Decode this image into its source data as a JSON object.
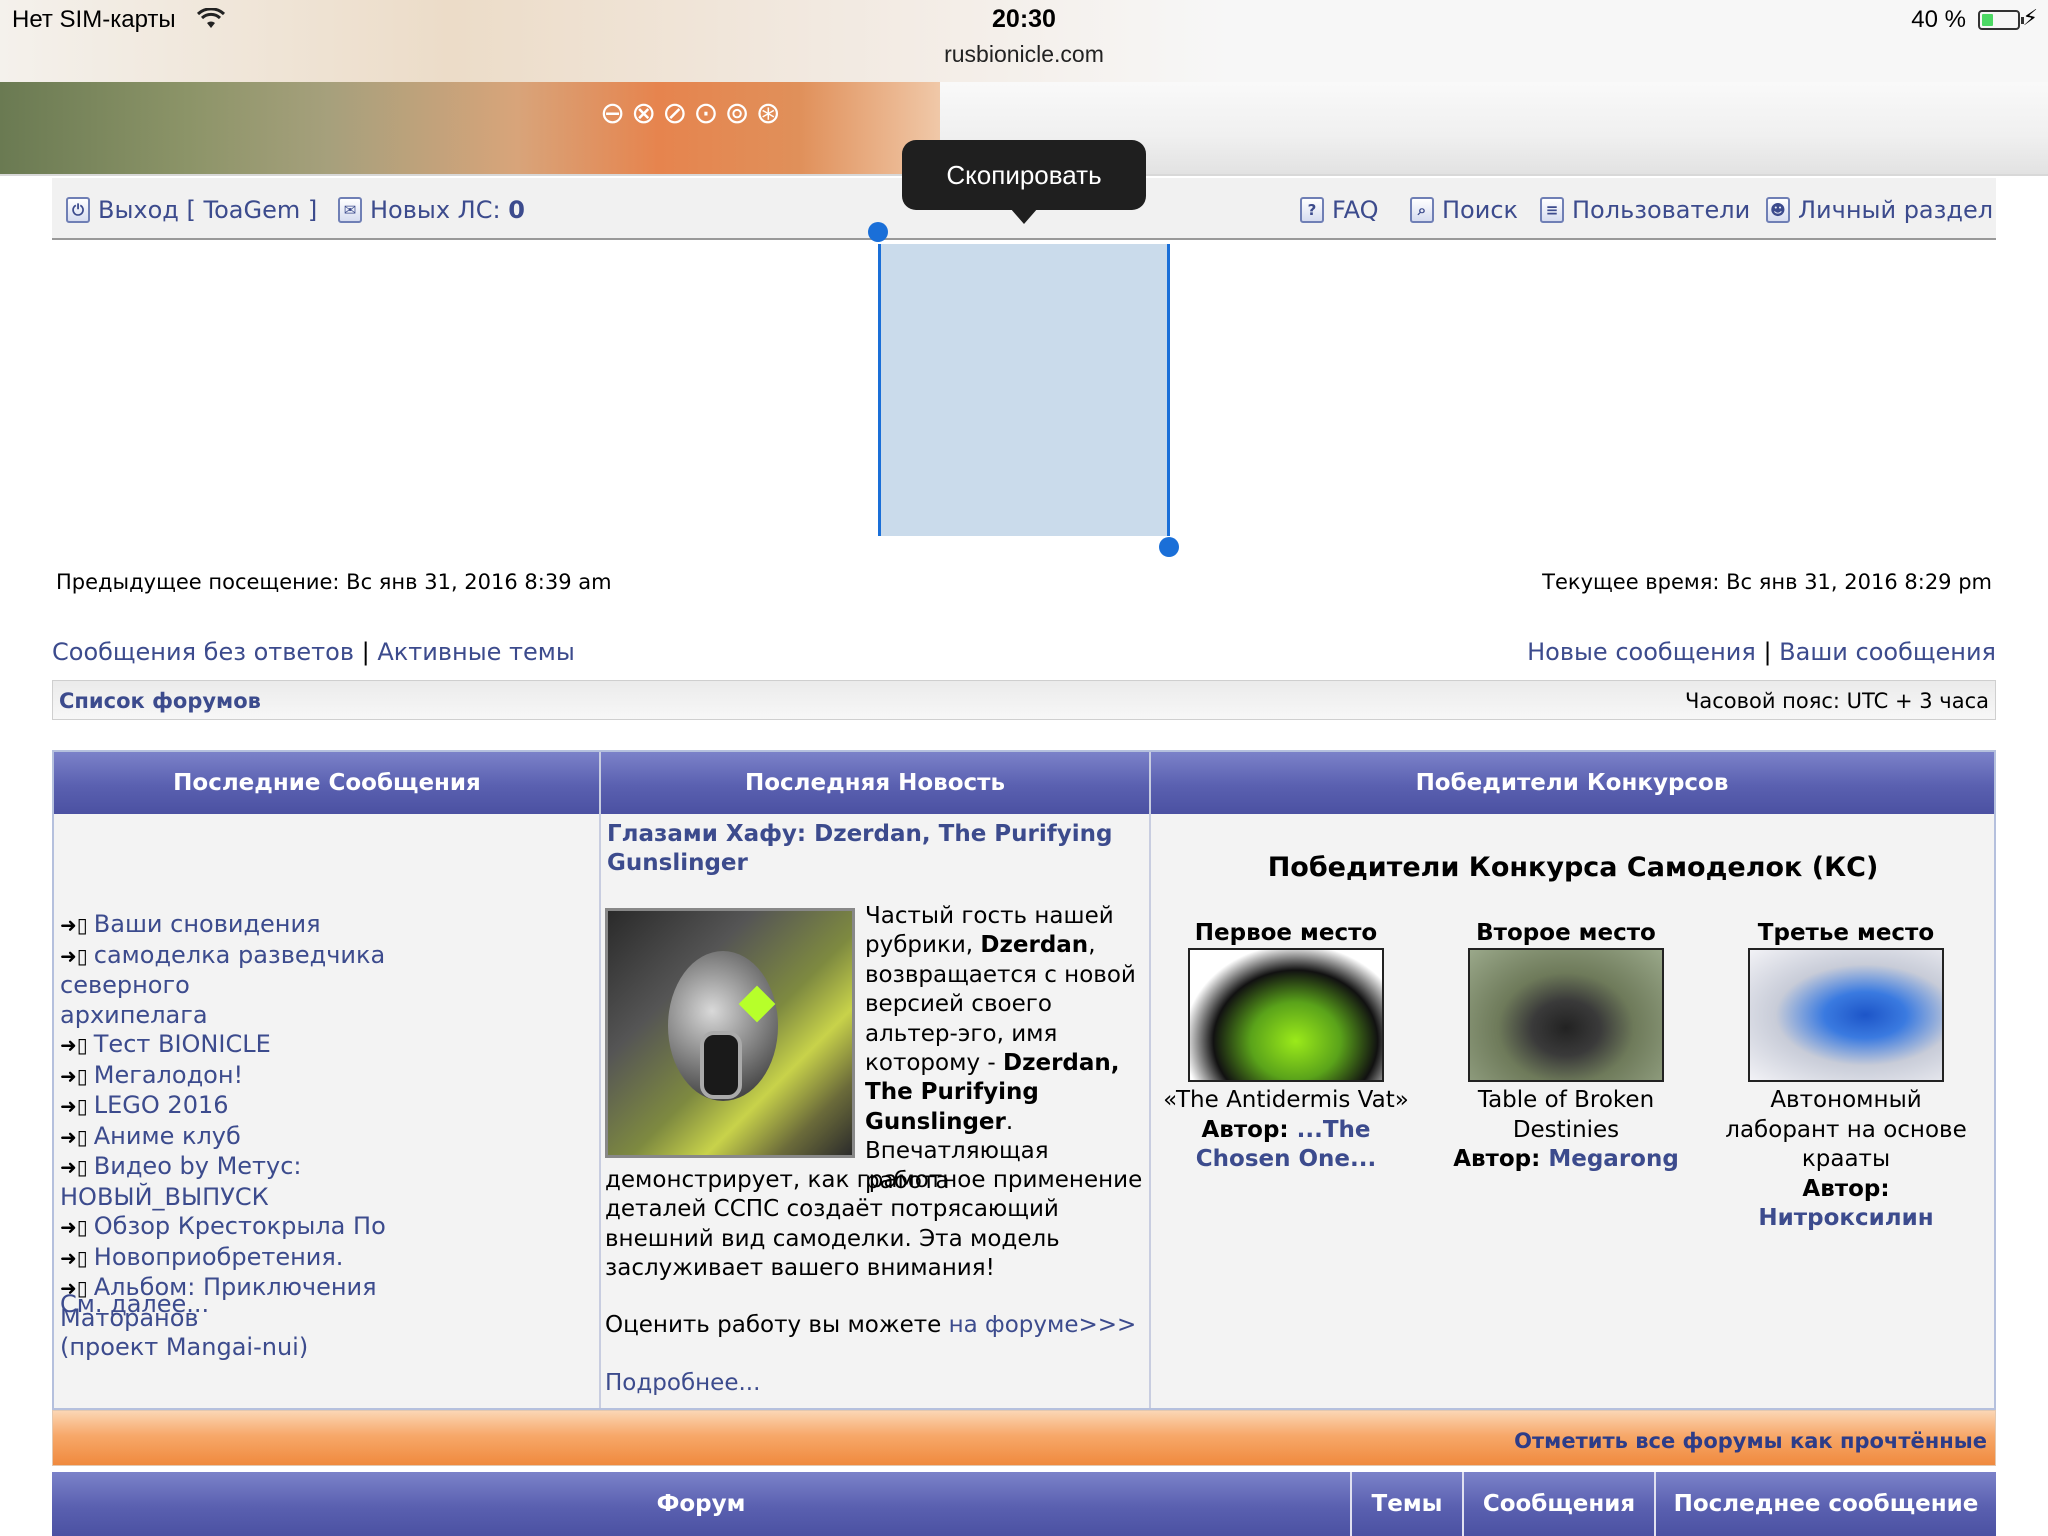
{
  "status_bar": {
    "carrier": "Нет SIM-карты",
    "time": "20:30",
    "url": "rusbionicle.com",
    "battery": "40 %",
    "battery_level": 0.4
  },
  "nav": {
    "logout": "Выход [ ToaGem ]",
    "new_pm_label": "Новых ЛС:",
    "new_pm_count": "0",
    "faq": "FAQ",
    "search": "Поиск",
    "members": "Пользователи",
    "ucp": "Личный раздел"
  },
  "tooltip": {
    "copy": "Скопировать"
  },
  "visit": {
    "last": "Предыдущее посещение: Вс янв 31, 2016 8:39 am",
    "current": "Текущее время: Вс янв 31, 2016 8:29 pm"
  },
  "search_links": {
    "unanswered": "Сообщения без ответов",
    "active": "Активные темы",
    "new_posts": "Новые сообщения",
    "your_posts": "Ваши сообщения",
    "sep": "|"
  },
  "breadcrumb": {
    "index": "Список форумов",
    "timezone": "Часовой пояс: UTC + 3 часа"
  },
  "portal": {
    "headers": {
      "recent": "Последние Сообщения",
      "news": "Последняя Новость",
      "winners": "Победители Конкурсов"
    },
    "recent": {
      "items": [
        "Ваши сновидения",
        "самоделка разведчика северного",
        "архипелага",
        "Тест BIONICLE",
        "Мегалодон!",
        "LEGO 2016",
        "Аниме клуб",
        "Видео by Метус: НОВЫЙ_ВЫПУСК",
        "Обзор Крестокрыла По",
        "Новоприобретения.",
        "Альбом: Приключения Маторанов",
        "(проект Mangai-nui)"
      ],
      "more": "См. далее..."
    },
    "news": {
      "title": "Глазами Хафу: Dzerdan, The Purifying Gunslinger",
      "p1_a": "Частый гость нашей рубрики, ",
      "p1_b": "Dzerdan",
      "p1_c": ", возвращается с новой версией своего альтер-эго, имя которому - ",
      "p1_d": "Dzerdan, The Purifying Gunslinger",
      "p1_e": ".",
      "p1_f": "Впечатляющая работа",
      "p2": "демонстрирует, как грамотное применение деталей ССПС создаёт потрясающий внешний вид самоделки. Эта модель заслуживает вашего внимания!",
      "rate_text": "Оценить работу вы можете ",
      "rate_link": "на форуме>>>",
      "more": "Подробнее..."
    },
    "winners": {
      "title": "Победители Конкурса Самоделок (КС)",
      "author_label": "Автор:",
      "places": [
        {
          "label": "Первое место",
          "caption": "«The Antidermis Vat»",
          "author": "...The Chosen One..."
        },
        {
          "label": "Второе место",
          "caption": "Table of Broken Destinies",
          "author": "Megarong"
        },
        {
          "label": "Третье место",
          "caption": "Автономный лаборант на основе крааты",
          "author": "Нитроксилин"
        }
      ]
    }
  },
  "mark_read": "Отметить все форумы как прочтённые",
  "forum_table": {
    "headers": {
      "forum": "Форум",
      "topics": "Темы",
      "posts": "Сообщения",
      "last_post": "Последнее сообщение"
    }
  },
  "colors": {
    "link": "#3c4b8d",
    "header_bg": "#5a60b0",
    "selection": "#cadbeb",
    "handle": "#1a6fd8",
    "markbar": "#f08a3e"
  }
}
